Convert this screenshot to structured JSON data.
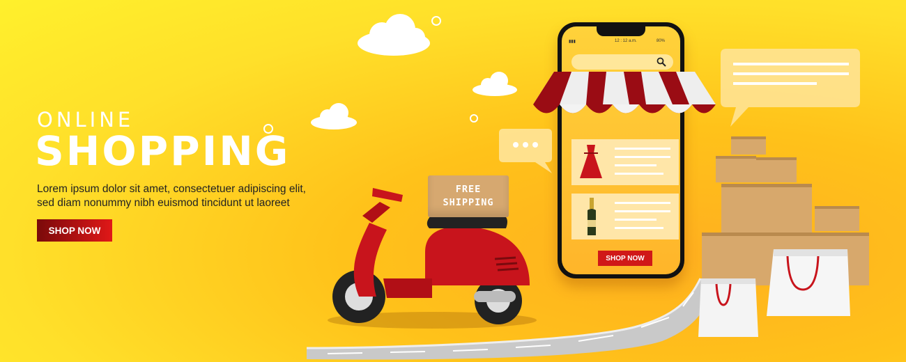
{
  "hero": {
    "line1": "ONLINE",
    "line2": "SHOPPING",
    "desc_line1": "Lorem ipsum dolor sit amet, consectetuer adipiscing elit,",
    "desc_line2": "sed diam nonummy nibh euismod tincidunt ut laoreet",
    "button_label": "SHOP NOW"
  },
  "package": {
    "line1": "FREE",
    "line2": "SHIPPING"
  },
  "phone": {
    "time": "12 : 12 a.m.",
    "battery": "80%",
    "button_label": "SHOP NOW"
  },
  "colors": {
    "background": "#ffd21f",
    "accent_red": "#d01818",
    "text_white": "#ffffff"
  }
}
